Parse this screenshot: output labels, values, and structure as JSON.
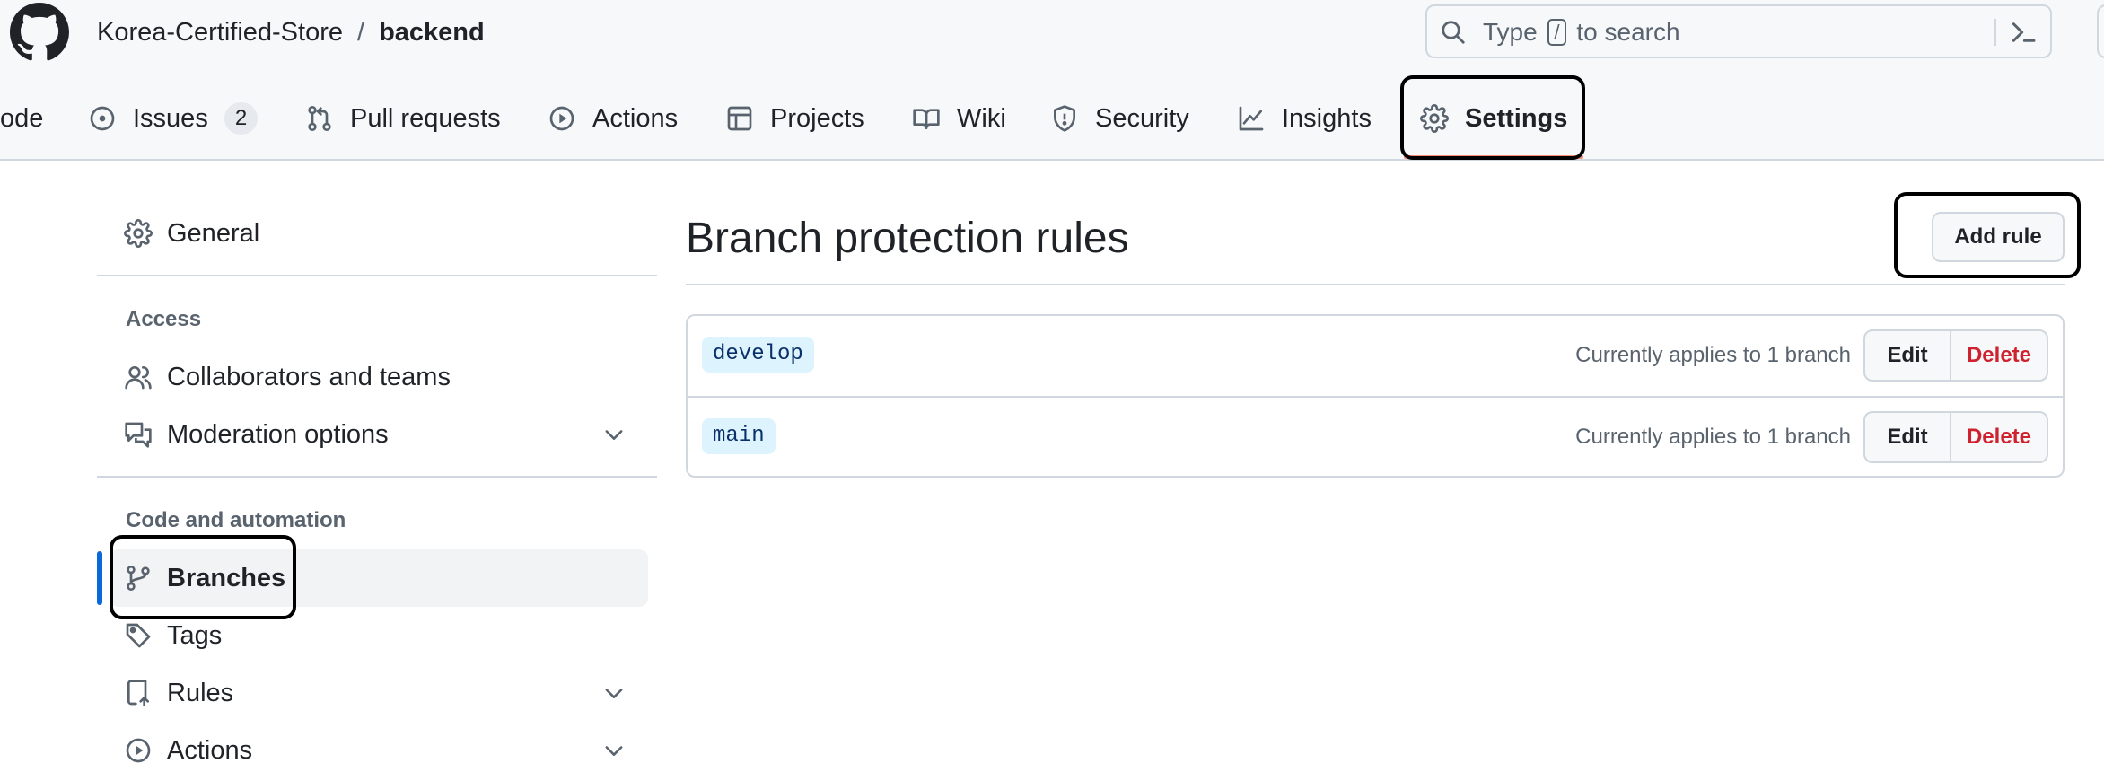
{
  "repo": {
    "owner": "Korea-Certified-Store",
    "separator": "/",
    "name": "backend"
  },
  "search": {
    "prefix": "Type",
    "key": "/",
    "suffix": "to search"
  },
  "tabs": [
    {
      "label": "ode",
      "icon": "code-icon"
    },
    {
      "label": "Issues",
      "icon": "issue-icon",
      "count": "2"
    },
    {
      "label": "Pull requests",
      "icon": "pull-request-icon"
    },
    {
      "label": "Actions",
      "icon": "play-icon"
    },
    {
      "label": "Projects",
      "icon": "table-icon"
    },
    {
      "label": "Wiki",
      "icon": "book-icon"
    },
    {
      "label": "Security",
      "icon": "shield-icon"
    },
    {
      "label": "Insights",
      "icon": "graph-icon"
    },
    {
      "label": "Settings",
      "icon": "gear-icon",
      "selected": true
    }
  ],
  "sidebar": {
    "general": "General",
    "access_heading": "Access",
    "collaborators": "Collaborators and teams",
    "moderation": "Moderation options",
    "code_heading": "Code and automation",
    "branches": "Branches",
    "tags": "Tags",
    "rules": "Rules",
    "actions": "Actions"
  },
  "main": {
    "title": "Branch protection rules",
    "add_rule": "Add rule",
    "rules": [
      {
        "branch": "develop",
        "applies": "Currently applies to 1 branch",
        "edit": "Edit",
        "delete": "Delete"
      },
      {
        "branch": "main",
        "applies": "Currently applies to 1 branch",
        "edit": "Edit",
        "delete": "Delete"
      }
    ]
  },
  "colors": {
    "accent": "#0969da",
    "danger": "#cf222e",
    "tab_underline": "#fd8c73",
    "tag_bg": "#ddf4ff"
  }
}
